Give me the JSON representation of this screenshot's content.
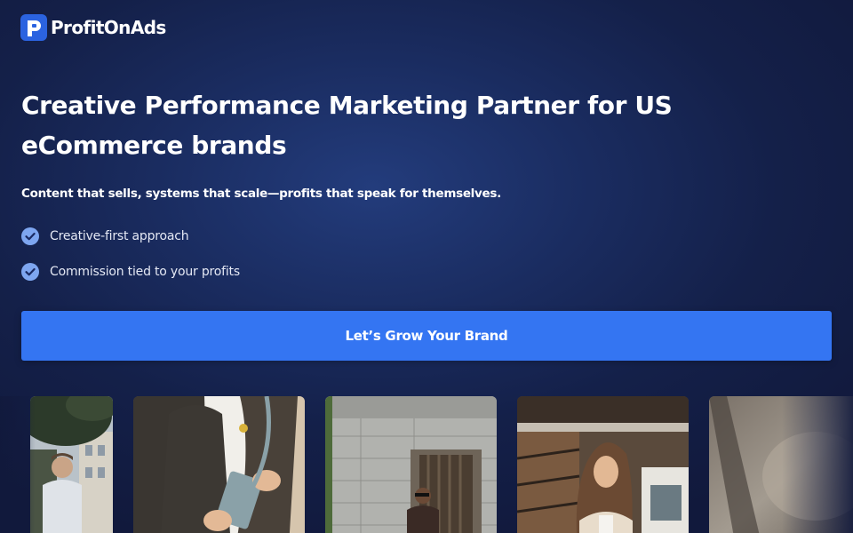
{
  "header": {
    "brand_name": "ProfitOnAds",
    "logo_icon": "profitonads-logo-icon"
  },
  "hero": {
    "title": "Creative Performance Marketing Partner for US eCommerce brands",
    "subtitle": "Content that sells, systems that scale—profits that speak for themselves.",
    "features": [
      {
        "icon": "check-circle-icon",
        "label": "Creative-first approach"
      },
      {
        "icon": "check-circle-icon",
        "label": "Commission tied to your profits"
      }
    ],
    "cta_label": "Let’s Grow Your Brand"
  },
  "gallery": {
    "cards": [
      {
        "subject": "man-near-tree-photo"
      },
      {
        "subject": "woman-with-wallet-photo"
      },
      {
        "subject": "man-by-stone-building-photo"
      },
      {
        "subject": "woman-smiling-street-photo"
      },
      {
        "subject": "blurred-photo"
      }
    ]
  },
  "colors": {
    "background": "#142049",
    "accent": "#3475f2",
    "check": "#7ea6f0",
    "text": "#ffffff"
  }
}
